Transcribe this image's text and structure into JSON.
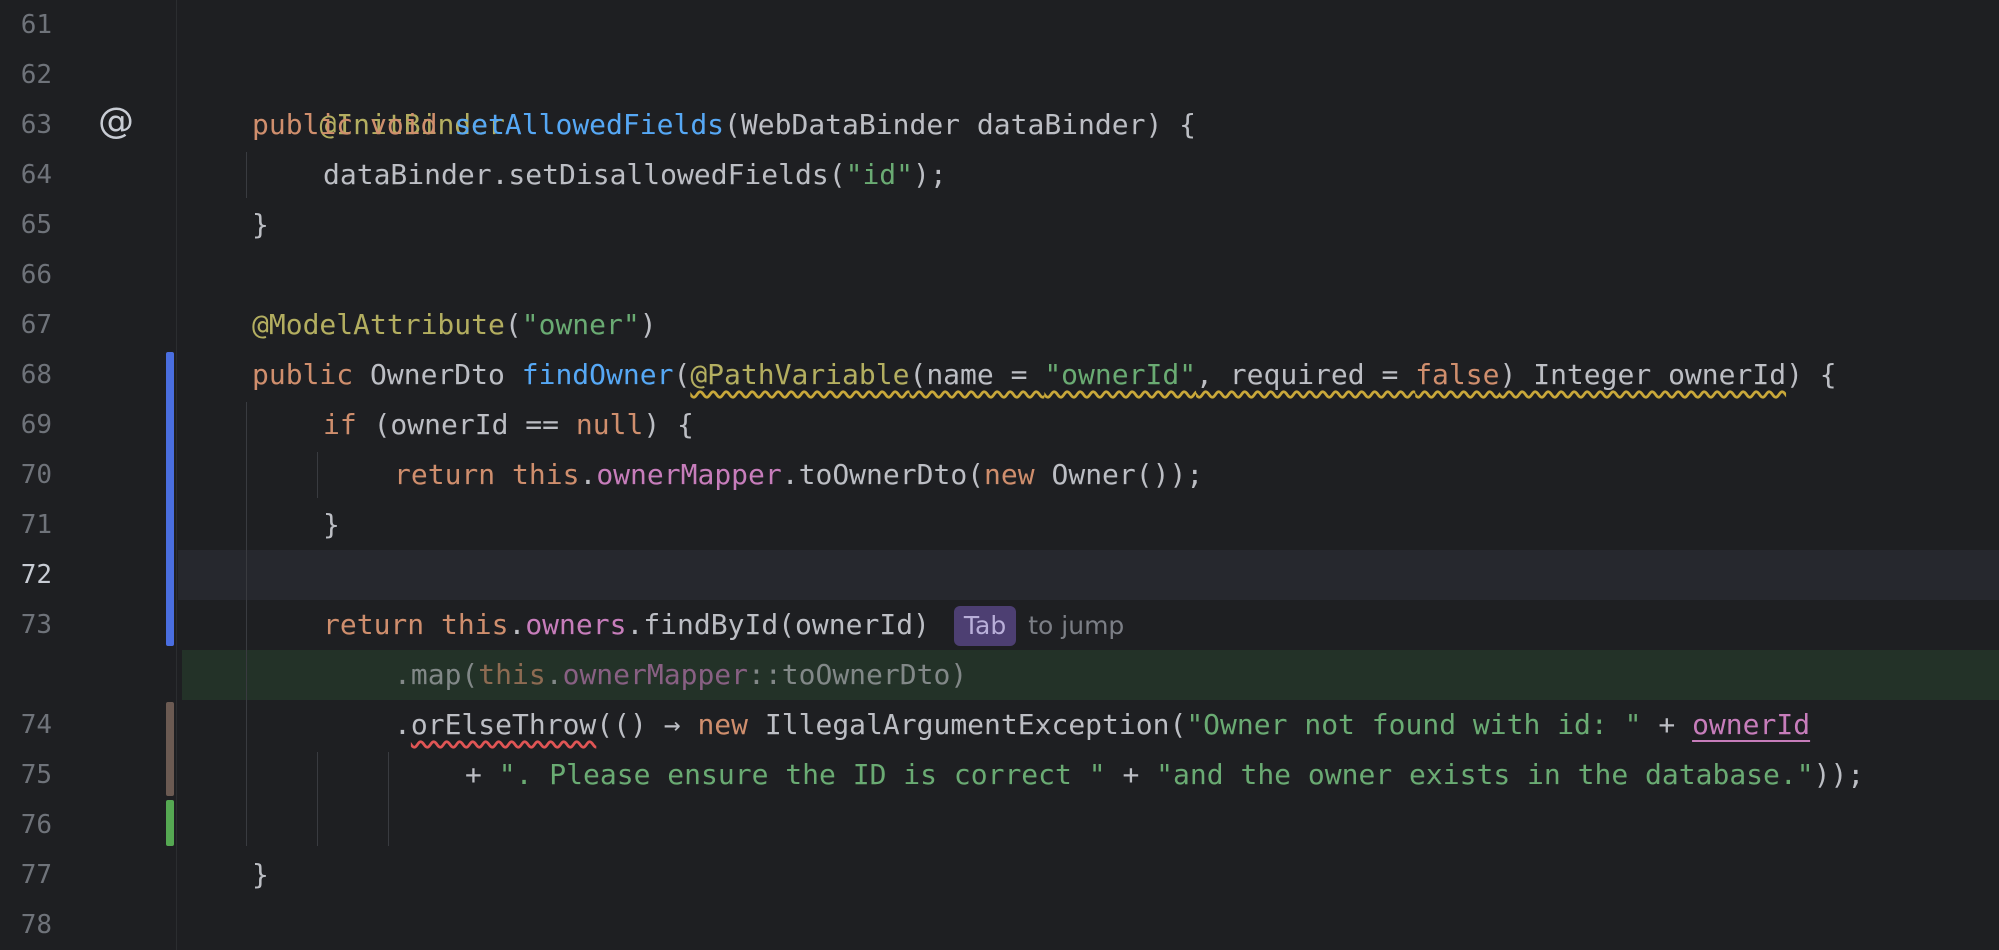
{
  "line_numbers": [
    "61",
    "62",
    "63",
    "64",
    "65",
    "66",
    "67",
    "68",
    "69",
    "70",
    "71",
    "72",
    "73",
    "74",
    "75",
    "76",
    "77",
    "78"
  ],
  "gutter_icon": "@",
  "code": {
    "l62": {
      "ann": "@InitBinder"
    },
    "l63": {
      "kw1": "public",
      "kw2": "void",
      "fn": "setAllowedFields",
      "rest": "(WebDataBinder dataBinder) {"
    },
    "l64": {
      "pre": "dataBinder.setDisallowedFields(",
      "str": "\"id\"",
      "post": ");"
    },
    "l65": {
      "text": "}"
    },
    "l67": {
      "ann": "@ModelAttribute",
      "open": "(",
      "str": "\"owner\"",
      "close": ")"
    },
    "l68": {
      "kw": "public",
      "type": " OwnerDto ",
      "fn": "findOwner",
      "open": "(",
      "ann": "@PathVariable",
      "p1": "(name = ",
      "str": "\"ownerId\"",
      "p2": ", required = ",
      "kwfalse": "false",
      "p3": ") Integer ownerId",
      "close": ") {"
    },
    "l69": {
      "kw": "if",
      "mid": " (ownerId == ",
      "kwnull": "null",
      "post": ") {"
    },
    "l70": {
      "kw1": "return",
      "kw2": "this",
      "dot": ".",
      "fld": "ownerMapper",
      "mid": ".toOwnerDto(",
      "kw3": "new",
      "post": " Owner());"
    },
    "l71": {
      "text": "}"
    },
    "l73": {
      "kw1": "return",
      "kw2": "this",
      "dot": ".",
      "fld": "owners",
      "mid": ".findById(ownerId)",
      "tab": "Tab",
      "hint": "to jump"
    },
    "suggest": {
      "pre": ".map(",
      "kw": "this",
      "dot": ".",
      "fld": "ownerMapper",
      "post": "::toOwnerDto)"
    },
    "l74": {
      "dot": ".",
      "typo": "orElseThrow",
      "mid": "(() → ",
      "kw": "new",
      "cls": " IllegalArgumentException(",
      "str": "\"Owner not found with id: \"",
      "plus": " + ",
      "fld": "ownerId"
    },
    "l75": {
      "plus1": "+ ",
      "str1": "\". Please ensure the ID is correct \"",
      "plus2": " + ",
      "str2": "\"and the owner exists in the database.\"",
      "post": "));"
    },
    "l77": {
      "text": "}"
    }
  }
}
